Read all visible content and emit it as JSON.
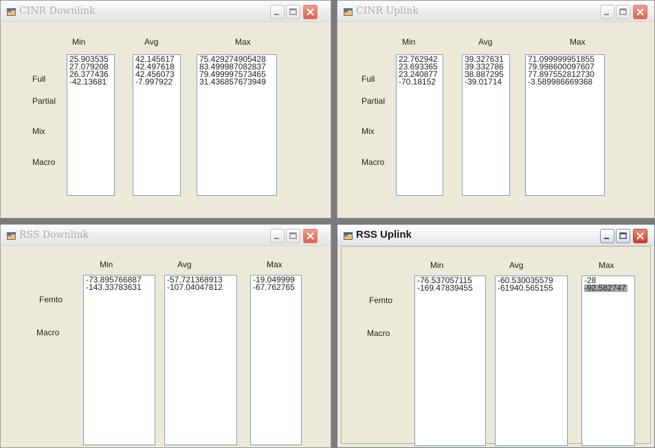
{
  "cinr_downlink": {
    "title": "CINR Downlink",
    "columns": [
      "Min",
      "Avg",
      "Max"
    ],
    "rows": [
      "Full",
      "Partial",
      "Mix",
      "Macro"
    ],
    "min": [
      "25.903535",
      "27.079208",
      "26.377436",
      "-42.13681"
    ],
    "avg": [
      "42.145617",
      "42.497618",
      "42.456073",
      "-7.997922"
    ],
    "max": [
      "75.429274905428",
      "83.499987082837",
      "79.499997573465",
      "31.436857673949"
    ]
  },
  "cinr_uplink": {
    "title": "CINR Uplink",
    "columns": [
      "Min",
      "Avg",
      "Max"
    ],
    "rows": [
      "Full",
      "Partial",
      "Mix",
      "Macro"
    ],
    "min": [
      "22.762942",
      "23.693365",
      "23.240877",
      "-70.18152"
    ],
    "avg": [
      "39.327631",
      "39.332786",
      "38.887295",
      "-39.01714"
    ],
    "max": [
      "71.099999951855",
      "79.998600097607",
      "77.897552812730",
      "-3.589986669368"
    ]
  },
  "rss_downlink": {
    "title": "RSS Downlink",
    "columns": [
      "Min",
      "Avg",
      "Max"
    ],
    "rows": [
      "Femto",
      "Macro"
    ],
    "min": [
      "-73.895766887",
      "-143.33783631"
    ],
    "avg": [
      "-57.721368913",
      "-107.04047812"
    ],
    "max": [
      "-19.049999",
      "-67.762765"
    ]
  },
  "rss_uplink": {
    "title": "RSS Uplink",
    "columns": [
      "Min",
      "Avg",
      "Max"
    ],
    "rows": [
      "Femto",
      "Macro"
    ],
    "min": [
      "-76.537057115",
      "-169.47839455"
    ],
    "avg": [
      "-60.530035579",
      "-61940.565155"
    ],
    "max": [
      "-28",
      "-92.582747"
    ],
    "selected_max_index": 1
  },
  "icons": {
    "app": "window-app-icon",
    "minimize": "minimize-icon",
    "maximize": "maximize-icon",
    "close": "close-icon"
  },
  "colors": {
    "window_bg": "#ece9d8",
    "listbox_border": "#7f9db9",
    "close_button": "#e0614a",
    "selection": "#a8a8a8"
  }
}
